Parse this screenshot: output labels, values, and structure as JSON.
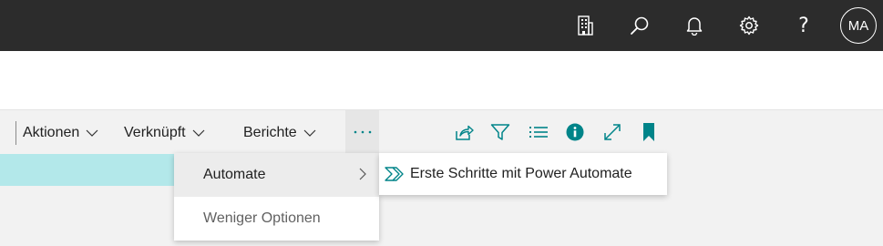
{
  "topbar": {
    "icons": [
      "company-icon",
      "search-icon",
      "bell-icon",
      "gear-icon",
      "help-icon"
    ],
    "help_glyph": "?",
    "avatar_initials": "MA"
  },
  "actionbar": {
    "menus": [
      {
        "label": "Aktionen"
      },
      {
        "label": "Verknüpft"
      },
      {
        "label": "Berichte"
      }
    ],
    "more_label": "···",
    "right_icons": [
      "share-icon",
      "filter-icon",
      "list-icon",
      "info-icon",
      "expand-icon",
      "bookmark-icon"
    ]
  },
  "dropdown": {
    "items": [
      {
        "label": "Automate",
        "has_submenu": true
      },
      {
        "label": "Weniger Optionen",
        "has_submenu": false
      }
    ]
  },
  "submenu": {
    "items": [
      {
        "label": "Erste Schritte mit Power Automate",
        "icon": "power-automate-icon"
      }
    ]
  },
  "colors": {
    "topbar_bg": "#2c2c2c",
    "accent_teal": "#008489",
    "selected_row": "#b3e8ea"
  }
}
